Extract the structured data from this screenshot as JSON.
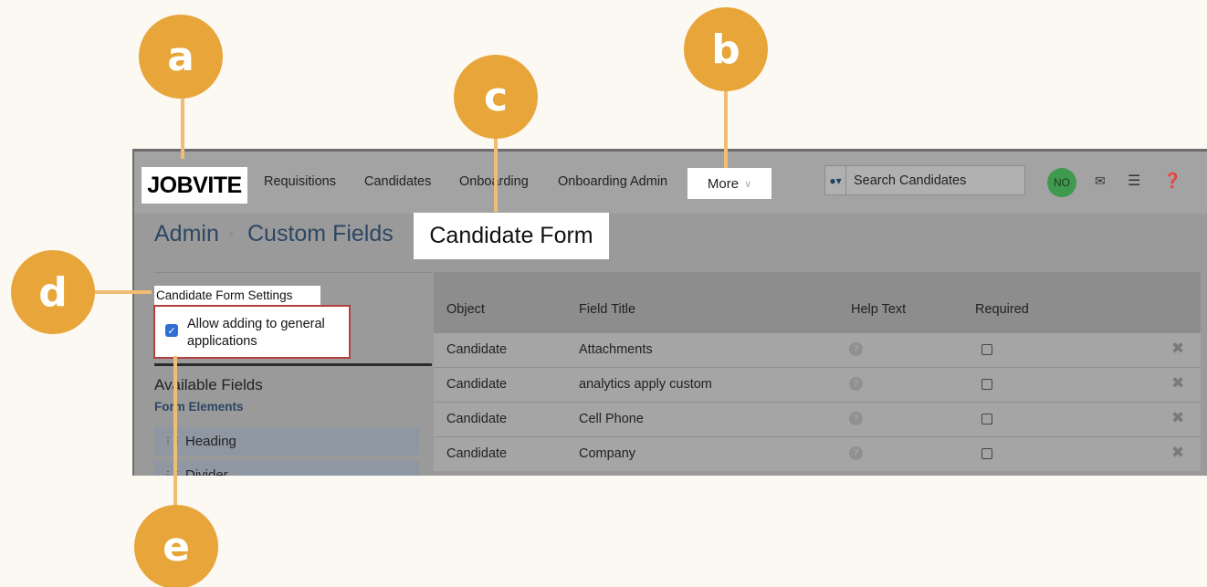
{
  "callouts": {
    "a": "a",
    "b": "b",
    "c": "c",
    "d": "d",
    "e": "e"
  },
  "header": {
    "logo": "JOBVITE",
    "nav": [
      "Requisitions",
      "Candidates",
      "Onboarding",
      "Onboarding Admin"
    ],
    "more_label": "More",
    "search_placeholder": "Search Candidates",
    "avatar_initials": "NO"
  },
  "breadcrumb": {
    "items": [
      "Admin",
      "Custom Fields"
    ],
    "current": "Candidate Form"
  },
  "sidebar": {
    "settings_title": "Candidate Form Settings",
    "allow_label": "Allow adding to general applications",
    "allow_checked": true,
    "available_fields": "Available Fields",
    "form_elements": "Form Elements",
    "elements": [
      "Heading",
      "Divider"
    ]
  },
  "table": {
    "columns": [
      "Object",
      "Field Title",
      "Help Text",
      "Required"
    ],
    "rows": [
      {
        "object": "Candidate",
        "field_title": "Attachments"
      },
      {
        "object": "Candidate",
        "field_title": "analytics apply custom"
      },
      {
        "object": "Candidate",
        "field_title": "Cell Phone"
      },
      {
        "object": "Candidate",
        "field_title": "Company"
      }
    ]
  },
  "colors": {
    "callout": "#e7a53a",
    "leader": "#f0bd72",
    "highlight_border": "#b54040",
    "checkbox": "#2e6fd1"
  }
}
